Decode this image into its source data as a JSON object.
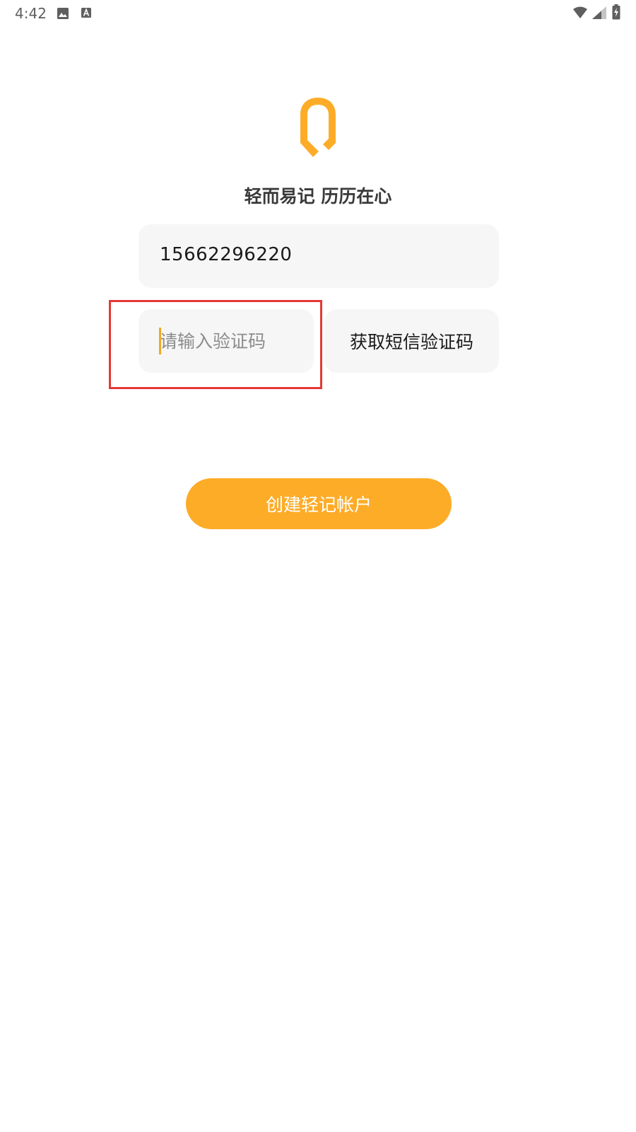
{
  "status_bar": {
    "time": "4:42",
    "icons": [
      "image-icon",
      "a-icon",
      "wifi-icon",
      "signal-icon",
      "battery-charging-icon"
    ]
  },
  "brand": {
    "accent_color": "#fdac28",
    "slogan": "轻而易记 历历在心"
  },
  "form": {
    "phone_value": "15662296220",
    "code_placeholder": "请输入验证码",
    "sms_button_label": "获取短信验证码",
    "create_button_label": "创建轻记帐户"
  },
  "highlight_color": "#e53935"
}
